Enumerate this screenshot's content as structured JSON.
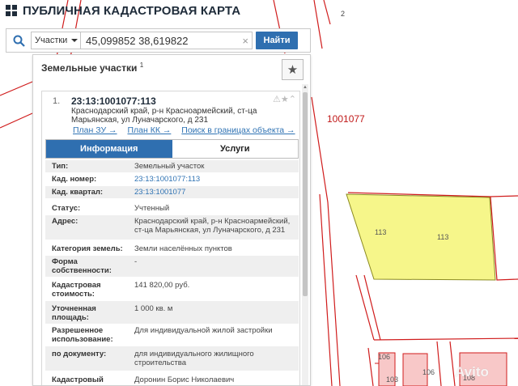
{
  "header": {
    "title": "ПУБЛИЧНАЯ КАДАСТРОВАЯ КАРТА"
  },
  "search": {
    "type_label": "Участки",
    "query": "45,099852 38,619822",
    "clear_symbol": "×",
    "button_label": "Найти"
  },
  "panel": {
    "title": "Земельные участки",
    "title_count": "1",
    "star_symbol": "★",
    "result": {
      "number": "1.",
      "cad_number": "23:13:1001077:113",
      "icons": "⚠★⌃",
      "address": "Краснодарский край, р-н Красноармейский, ст-ца Марьянская, ул Луначарского, д 231",
      "links": [
        "План ЗУ →",
        "План КК →",
        "Поиск в границах объекта →"
      ]
    },
    "tabs": [
      {
        "label": "Информация",
        "active": true
      },
      {
        "label": "Услуги",
        "active": false
      }
    ],
    "attributes": [
      {
        "key": "Тип:",
        "value": "Земельный участок"
      },
      {
        "key": "Кад. номер:",
        "value": "23:13:1001077:113",
        "link": true
      },
      {
        "key": "Кад. квартал:",
        "value": "23:13:1001077",
        "link": true
      },
      {
        "key": "Статус:",
        "value": "Учтенный"
      },
      {
        "key": "Адрес:",
        "value": "Краснодарский край, р-н Красноармейский, ст-ца Марьянская, ул Луначарского, д 231"
      },
      {
        "key": "Категория земель:",
        "value": "Земли населённых пунктов"
      },
      {
        "key": "Форма собственности:",
        "value": "-"
      },
      {
        "key": "Кадастровая стоимость:",
        "value": "141 820,00 руб."
      },
      {
        "key": "Уточненная площадь:",
        "value": "1 000 кв. м"
      },
      {
        "key": "Разрешенное использование:",
        "value": "Для индивидуальной жилой застройки"
      },
      {
        "key": "по документу:",
        "value": "для индивидуального жилищного строительства"
      },
      {
        "key": "Кадастровый",
        "value": "Доронин Борис Николаевич"
      }
    ]
  },
  "map": {
    "labels": {
      "quarter": "1001077",
      "top_num": "2",
      "parcel_113_a": "113",
      "parcel_113_b": "113",
      "parcel_106": "106",
      "parcel_106b": "106",
      "parcel_108": "108",
      "parcel_103": "103"
    },
    "colors": {
      "boundary": "#d01c1c",
      "selected_fill": "#f6f68a",
      "selected_stroke": "#9a9a2a",
      "building_fill": "#f8c8c8"
    }
  },
  "watermark": "Avito"
}
